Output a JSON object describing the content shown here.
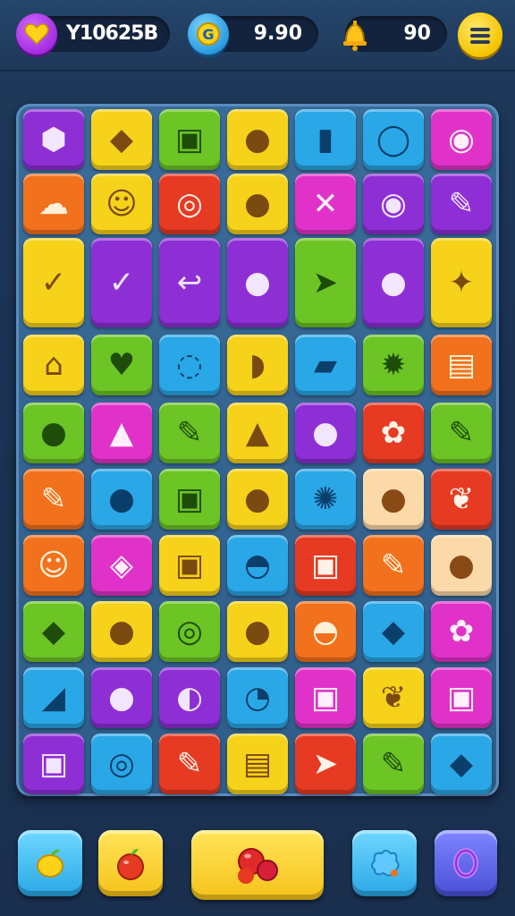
{
  "hud": {
    "score_value": "Y10625B",
    "coins_value": "9.90",
    "lives_value": "90"
  },
  "board": {
    "rows": [
      [
        "⬢",
        "◆",
        "▣",
        "●",
        "▮",
        "◯",
        "◉"
      ],
      [
        "☁",
        "☺",
        "◎",
        "●",
        "✕",
        "◉",
        "✎"
      ],
      [
        "✓",
        "✓",
        "↩",
        "●",
        "➤",
        "●",
        "✦"
      ],
      [
        "⌂",
        "♥",
        "◌",
        "◗",
        "▰",
        "✹",
        "▤"
      ],
      [
        "●",
        "▲",
        "✎",
        "▲",
        "●",
        "✿",
        "✎"
      ],
      [
        "✎",
        "●",
        "▣",
        "●",
        "✺",
        "●",
        "❦"
      ],
      [
        "☺",
        "◈",
        "▣",
        "◓",
        "▣",
        "✎",
        "●"
      ],
      [
        "◆",
        "●",
        "◎",
        "●",
        "◓",
        "◆",
        "✿"
      ],
      [
        "◢",
        "●",
        "◐",
        "◔",
        "▣",
        "❦",
        "▣"
      ],
      [
        "▣",
        "◎",
        "✎",
        "▤",
        "➤",
        "✎",
        "◆"
      ]
    ]
  },
  "colors": {
    "yellow": "#f6d21a",
    "purple": "#8e2fd6",
    "green": "#6cc425",
    "blue": "#2aa7e6",
    "orange": "#f2711c",
    "magenta": "#e032c8",
    "red": "#e63a22",
    "peach": "#fbd9a8",
    "background": "#1b3253",
    "board": "#3a6c9a"
  },
  "bottom_bar": {
    "slots": [
      "lemon-icon",
      "apple-icon",
      "berries-icon",
      "splat-icon",
      "ring-icon"
    ]
  }
}
